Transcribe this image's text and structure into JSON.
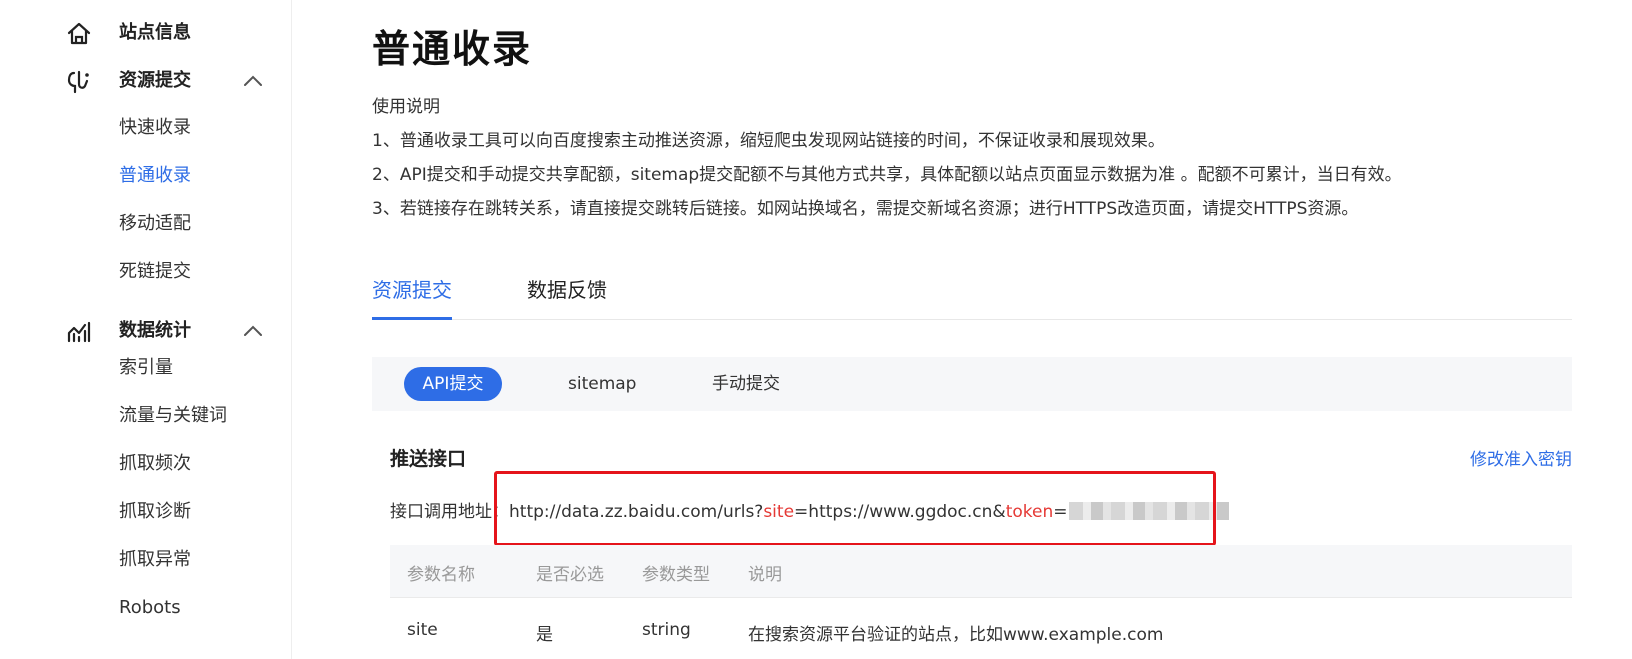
{
  "sidebar": {
    "groups": [
      {
        "label": "站点信息",
        "icon": "home-icon"
      },
      {
        "label": "资源提交",
        "icon": "submit-resource-icon",
        "items": [
          "快速收录",
          "普通收录",
          "移动适配",
          "死链提交"
        ]
      },
      {
        "label": "数据统计",
        "icon": "chart-stats-icon",
        "items": [
          "索引量",
          "流量与关键词",
          "抓取频次",
          "抓取诊断",
          "抓取异常",
          "Robots"
        ]
      }
    ],
    "active_item": "普通收录"
  },
  "main": {
    "title": "普通收录",
    "instructions": {
      "heading": "使用说明",
      "lines": [
        "1、普通收录工具可以向百度搜索主动推送资源，缩短爬虫发现网站链接的时间，不保证收录和展现效果。",
        "2、API提交和手动提交共享配额，sitemap提交配额不与其他方式共享，具体配额以站点页面显示数据为准 。配额不可累计，当日有效。",
        "3、若链接存在跳转关系，请直接提交跳转后链接。如网站换域名，需提交新域名资源；进行HTTPS改造页面，请提交HTTPS资源。"
      ]
    },
    "tabs": [
      {
        "label": "资源提交",
        "active": true
      },
      {
        "label": "数据反馈",
        "active": false
      }
    ],
    "subtabs": [
      {
        "label": "API提交",
        "active": true
      },
      {
        "label": "sitemap",
        "active": false
      },
      {
        "label": "手动提交",
        "active": false
      }
    ],
    "section_title": "推送接口",
    "modify_key_link": "修改准入密钥",
    "api": {
      "label": "接口调用地址：",
      "url_prefix": "http://data.zz.baidu.com/urls?",
      "param_site": "site",
      "site_value": "=https://www.ggdoc.cn&",
      "param_token": "token",
      "token_eq": "="
    },
    "table": {
      "headers": [
        "参数名称",
        "是否必选",
        "参数类型",
        "说明"
      ],
      "rows": [
        [
          "site",
          "是",
          "string",
          "在搜索资源平台验证的站点，比如www.example.com"
        ]
      ]
    }
  },
  "colors": {
    "accent": "#2e6de6",
    "highlight": "#e5141b",
    "param_red": "#e53935"
  }
}
